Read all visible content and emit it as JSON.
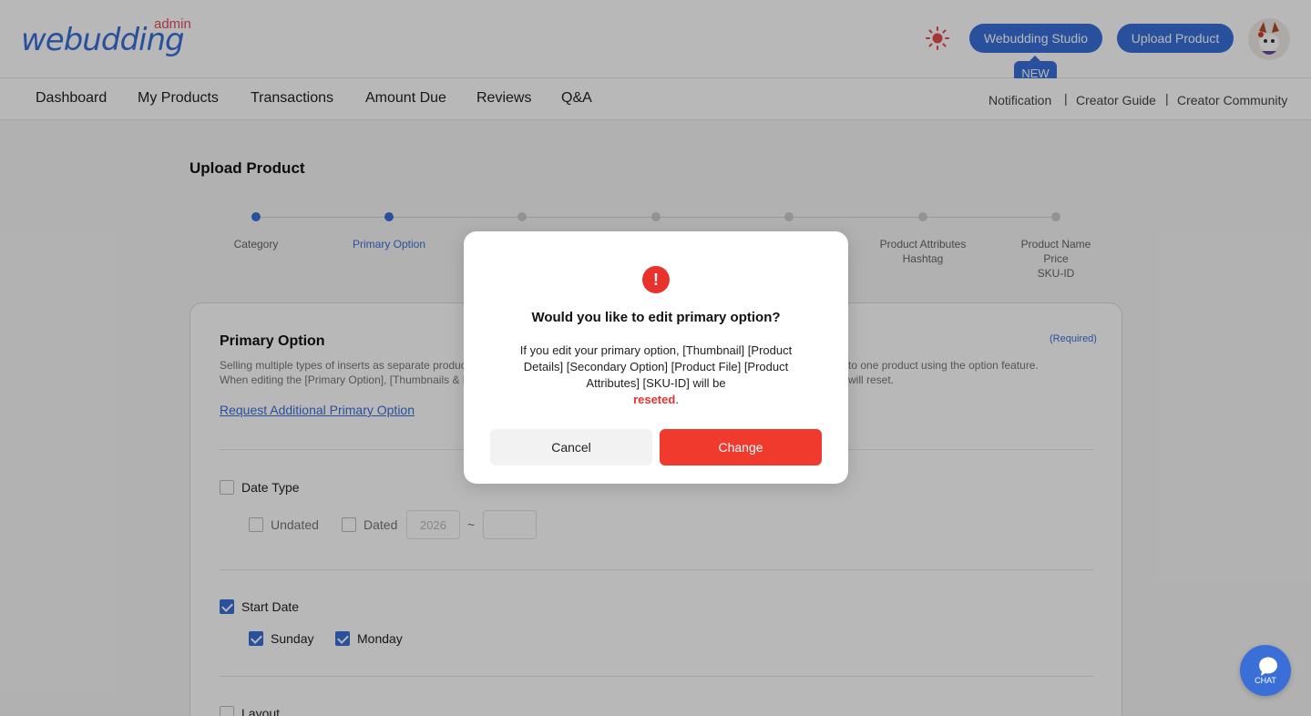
{
  "header": {
    "logo_text": "webudding",
    "logo_sub": "admin",
    "studio_button": "Webudding Studio",
    "upload_button": "Upload Product",
    "new_badge": "NEW",
    "theme_icon": "sun-icon"
  },
  "nav": {
    "items": [
      "Dashboard",
      "My Products",
      "Transactions",
      "Amount Due",
      "Reviews",
      "Q&A"
    ],
    "right": [
      "Notification",
      "Creator Guide",
      "Creator Community"
    ],
    "separator": "|"
  },
  "page": {
    "title": "Upload Product",
    "steps": [
      {
        "label": "Category",
        "state": "done"
      },
      {
        "label": "Primary Option",
        "state": "active"
      },
      {
        "label": "",
        "state": "pending"
      },
      {
        "label": "",
        "state": "pending"
      },
      {
        "label": "",
        "state": "pending"
      },
      {
        "label": "Product Attributes\nHashtag",
        "state": "pending"
      },
      {
        "label": "Product Name\nPrice\nSKU-ID",
        "state": "pending"
      }
    ]
  },
  "card": {
    "title": "Primary Option",
    "required": "(Required)",
    "desc_line1_left": "Selling multiple types of inserts as separate produc",
    "desc_line1_right": "to one product using the option feature.",
    "desc_line2_left": "When editing the [Primary Option], [Thumbnails & P",
    "desc_line2_right": "will reset.",
    "request_link": "Request Additional Primary Option",
    "date_type": {
      "label": "Date Type",
      "checked": false
    },
    "undated": {
      "label": "Undated",
      "checked": false
    },
    "dated": {
      "label": "Dated",
      "checked": false
    },
    "date_from_placeholder": "2026",
    "date_to_placeholder": "",
    "date_sep": "~",
    "start_date": {
      "label": "Start Date",
      "checked": true
    },
    "sunday": {
      "label": "Sunday",
      "checked": true
    },
    "monday": {
      "label": "Monday",
      "checked": true
    },
    "layout": {
      "label": "Layout",
      "checked": false
    }
  },
  "modal": {
    "title": "Would you like to edit primary option?",
    "body_main": "If you edit your primary option, [Thumbnail] [Product Details] [Secondary Option] [Product File] [Product Attributes] [SKU-ID] will be",
    "body_warn": "reseted",
    "body_end": ".",
    "cancel": "Cancel",
    "change": "Change",
    "accent_color": "#e8332c"
  },
  "chat": {
    "label": "CHAT"
  },
  "colors": {
    "brand": "#3a6fd8",
    "danger": "#e8332c"
  }
}
